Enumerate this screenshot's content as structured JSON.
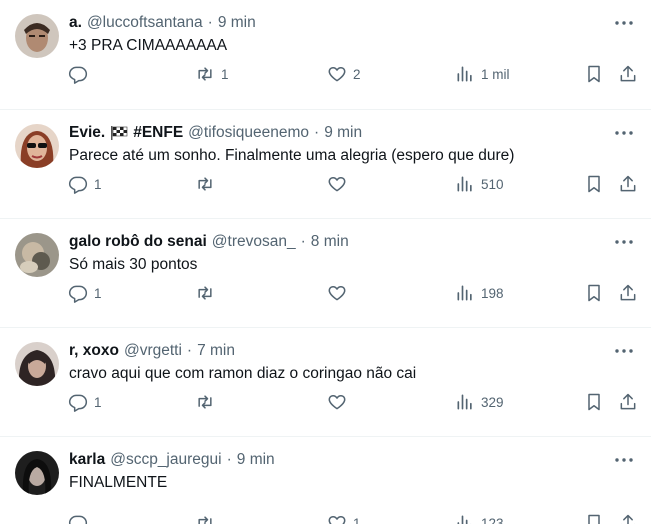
{
  "tweets": [
    {
      "name": "a.",
      "handle": "@luccoftsantana",
      "time": "9 min",
      "text": "+3 PRA CIMAAAAAAA",
      "replies": "",
      "retweets": "1",
      "likes": "2",
      "views": "1 mil",
      "avatar_color": "#6b5a4e"
    },
    {
      "name": "Evie.",
      "name_suffix": "#ENFE",
      "handle": "@tifosiqueenemo",
      "time": "9 min",
      "text": "Parece até um sonho. Finalmente uma alegria (espero que dure)",
      "replies": "1",
      "retweets": "",
      "likes": "",
      "views": "510",
      "avatar_color": "#a0523a"
    },
    {
      "name": "galo robô do senai",
      "handle": "@trevosan_",
      "time": "8 min",
      "text": "Só mais 30 pontos",
      "replies": "1",
      "retweets": "",
      "likes": "",
      "views": "198",
      "avatar_color": "#8a8576"
    },
    {
      "name": "r, xoxo",
      "handle": "@vrgetti",
      "time": "7 min",
      "text": "cravo aqui que com ramon diaz o coringao não cai",
      "replies": "1",
      "retweets": "",
      "likes": "",
      "views": "329",
      "avatar_color": "#3c3232"
    },
    {
      "name": "karla",
      "handle": "@sccp_jauregui",
      "time": "9 min",
      "text": "FINALMENTE",
      "replies": "",
      "retweets": "",
      "likes": "1",
      "views": "123",
      "avatar_color": "#2a2a2a"
    }
  ],
  "colors": {
    "text": "#0f1419",
    "secondary": "#536471",
    "divider": "#eff3f4"
  }
}
